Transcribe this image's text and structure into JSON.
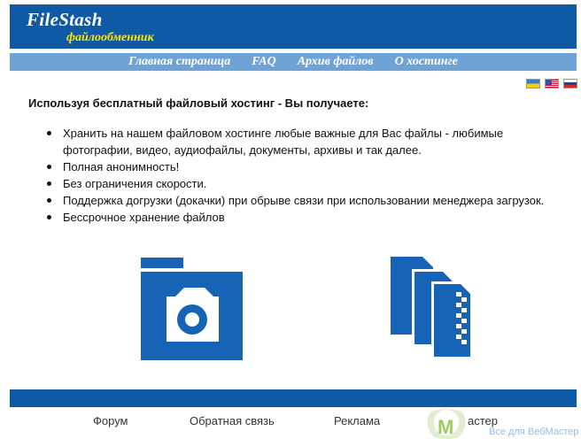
{
  "header": {
    "logo_title": "FileStash",
    "logo_subtitle": "файлообменник"
  },
  "nav": {
    "items": [
      "Главная страница",
      "FAQ",
      "Архив файлов",
      "О хостинге"
    ]
  },
  "languages": [
    "ua-flag-icon",
    "us-flag-icon",
    "ru-flag-icon"
  ],
  "main": {
    "intro": "Используя бесплатный файловый хостинг - Вы получаете:",
    "features": [
      "Хранить на нашем файловом хостинге любые важные для Вас файлы - любимые фотографии, видео, аудиофайлы, документы, архивы и так далее.",
      "Полная анонимность!",
      "Без ограничения скорости.",
      "Поддержка догрузки (докачки) при обрыве связи при использовании менеджера загрузок.",
      "Бессрочное хранение файлов"
    ]
  },
  "footer": {
    "links": [
      "Форум",
      "Обратная связь",
      "Реклама",
      "астер"
    ]
  },
  "watermark": {
    "letter": "M",
    "text": "Все для ВебМастер"
  },
  "colors": {
    "brand_blue": "#0f5aa6",
    "nav_blue": "#6fa3d6",
    "logo_yellow": "#ffe600"
  }
}
